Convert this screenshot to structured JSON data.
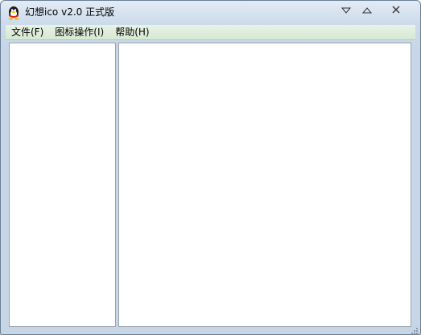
{
  "window": {
    "title": "幻想ico v2.0 正式版"
  },
  "menu": {
    "items": [
      "文件(F)",
      "图标操作(I)",
      "帮助(H)"
    ]
  },
  "icons": {
    "app": "qq-penguin-icon",
    "minimize": "triangle-down-icon",
    "maximize": "triangle-up-icon",
    "close": "close-x-icon"
  }
}
